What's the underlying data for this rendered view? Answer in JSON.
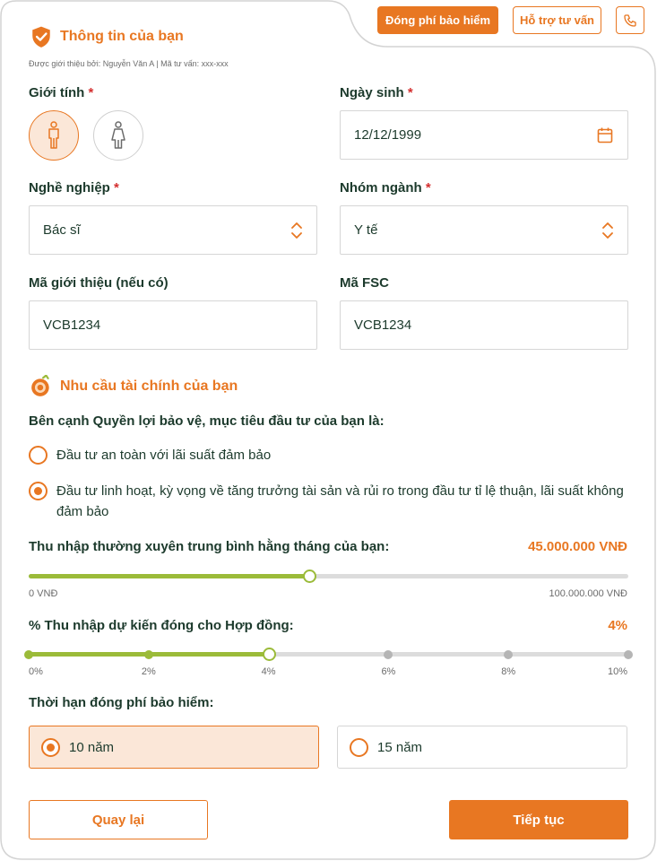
{
  "header": {
    "pay_label": "Đóng phí bảo hiểm",
    "support_label": "Hỗ trợ tư vấn"
  },
  "personal": {
    "title": "Thông tin của bạn",
    "referral_note": "Được giới thiệu bởi: Nguyễn Văn A | Mã tư vấn: xxx-xxx",
    "gender_label": "Giới tính",
    "gender_selected": "male",
    "dob_label": "Ngày sinh",
    "dob_value": "12/12/1999",
    "occupation_label": "Nghề nghiệp",
    "occupation_value": "Bác sĩ",
    "industry_label": "Nhóm ngành",
    "industry_value": "Y tế",
    "referral_code_label": "Mã giới thiệu (nếu có)",
    "referral_code_value": "VCB1234",
    "fsc_label": "Mã FSC",
    "fsc_value": "VCB1234",
    "required_mark": "*"
  },
  "finance": {
    "title": "Nhu cầu tài chính của bạn",
    "question": "Bên cạnh Quyền lợi bảo vệ, mục tiêu đầu tư của bạn là:",
    "options": [
      {
        "label": "Đầu tư an toàn với lãi suất đảm bảo",
        "checked": false
      },
      {
        "label": "Đầu tư linh hoạt, kỳ vọng về tăng trưởng tài sản và rủi ro trong đầu tư tỉ lệ thuận, lãi suất không đảm bảo",
        "checked": true
      }
    ],
    "income_label": "Thu nhập thường xuyên trung bình hằng tháng của bạn:",
    "income_value": "45.000.000 VNĐ",
    "income_fraction": 0.45,
    "income_min": "0 VNĐ",
    "income_max": "100.000.000 VNĐ",
    "percent_label": "% Thu nhập dự kiến đóng cho Hợp đồng:",
    "percent_value": "4%",
    "percent_steps": [
      "0%",
      "2%",
      "4%",
      "6%",
      "8%",
      "10%"
    ],
    "percent_selected_index": 2,
    "term_label": "Thời hạn đóng phí bảo hiểm:",
    "term_options": [
      "10 năm",
      "15 năm"
    ],
    "term_selected_index": 0
  },
  "actions": {
    "back_label": "Quay lại",
    "next_label": "Tiếp tục"
  },
  "colors": {
    "accent": "#e87722",
    "accent_light": "#fbe7d8",
    "slider_fill": "#9bbb39",
    "heading_text": "#1c3a2c"
  }
}
